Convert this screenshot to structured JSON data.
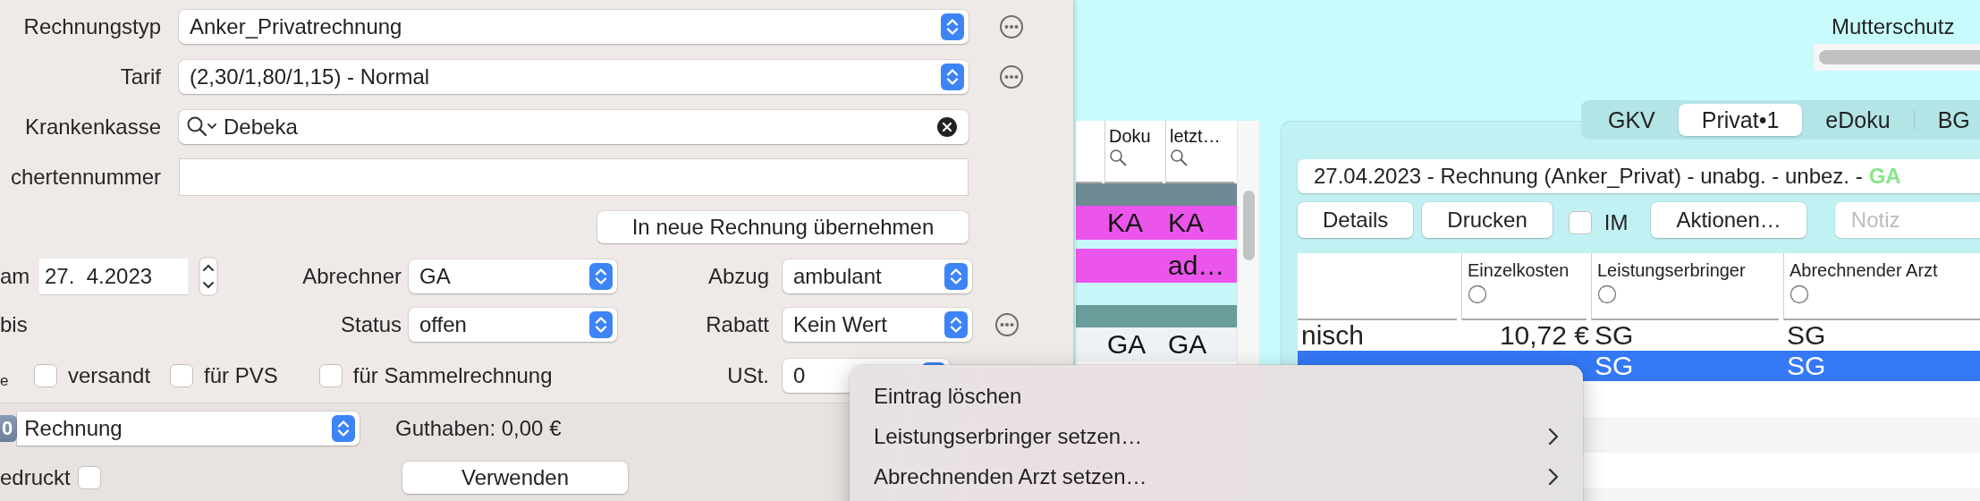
{
  "invoice_form": {
    "fields": [
      {
        "label": "Rechnungstyp",
        "kind": "select",
        "value": "Anker_Privatrechnung",
        "more": true
      },
      {
        "label": "Tarif",
        "kind": "select",
        "value": "(2,30/1,80/1,15) - Normal",
        "more": true
      },
      {
        "label": "Krankenkasse",
        "kind": "search",
        "value": "Debeka",
        "more": false
      },
      {
        "label": "chertennummer",
        "kind": "text",
        "more": false
      }
    ],
    "apply_button": "In neue Rechnung übernehmen",
    "date": {
      "label": "am",
      "value": "27.  4.2023"
    },
    "end_label": "bis",
    "selects": [
      {
        "label": "Abrechner",
        "value": "GA"
      },
      {
        "label": "Abzug",
        "value": "ambulant",
        "more": false
      },
      {
        "label": "Status",
        "value": "offen"
      },
      {
        "label": "Rabatt",
        "value": "Kein Wert",
        "more": true
      }
    ],
    "flags_label": "e",
    "checkboxes": [
      {
        "label": "versandt",
        "checked": false
      },
      {
        "label": "für PVS",
        "checked": false
      },
      {
        "label": "für Sammelrechnung",
        "checked": false
      }
    ],
    "vat": {
      "label": "USt.",
      "value": "0"
    }
  },
  "document_bar": {
    "badge": "0",
    "type": "Rechnung",
    "balance": "Guthaben: 0,00 €",
    "printed": {
      "label": "edruckt",
      "checked": false
    },
    "use_button": "Verwenden"
  },
  "top_right": {
    "label": "Mutterschutz"
  },
  "patient_list": {
    "columns": [
      "Doku",
      "letzt…"
    ],
    "rows": [
      {
        "kind": "blank",
        "color": "#6e8a94"
      },
      {
        "kind": "text",
        "color": "#ec55ec",
        "cells": [
          "KA",
          "KA"
        ]
      },
      {
        "kind": "thin",
        "color": "#c8f6f8"
      },
      {
        "kind": "text",
        "color": "#ec55ec",
        "cells": [
          "",
          "ad…"
        ]
      },
      {
        "kind": "blank",
        "color": "#c8f6f8"
      },
      {
        "kind": "blank",
        "color": "#6a9c9c"
      },
      {
        "kind": "text",
        "color": "#eef2f6",
        "cells": [
          "GA",
          "GA"
        ]
      }
    ]
  },
  "invoice_panel": {
    "tabs": [
      {
        "label": "GKV",
        "selected": false
      },
      {
        "label": "Privat•1",
        "selected": true
      },
      {
        "label": "eDoku",
        "selected": false
      },
      {
        "label": "BG",
        "selected": false
      }
    ],
    "title": "27.04.2023 - Rechnung (Anker_Privat) - unabg. - unbez. -",
    "title_tag": "GA",
    "buttons": [
      "Details",
      "Drucken"
    ],
    "im_checkbox": {
      "label": "IM",
      "checked": false
    },
    "actions_button": "Aktionen…",
    "note": {
      "placeholder": "Notiz"
    },
    "table": {
      "columns": [
        "Einzelkosten",
        "Leistungserbringer",
        "Abrechnender Arzt"
      ],
      "rows": [
        {
          "column_1": "nisch",
          "cost": "10,72 €",
          "provider": "SG",
          "doctor": "SG",
          "selected": false
        },
        {
          "provider": "SG",
          "doctor": "SG",
          "selected": true
        }
      ]
    }
  },
  "context_menu": {
    "items": [
      {
        "label": "Eintrag löschen",
        "submenu": false
      },
      {
        "label": "Leistungserbringer setzen…",
        "submenu": true
      },
      {
        "label": "Abrechnenden Arzt setzen…",
        "submenu": true
      }
    ]
  }
}
